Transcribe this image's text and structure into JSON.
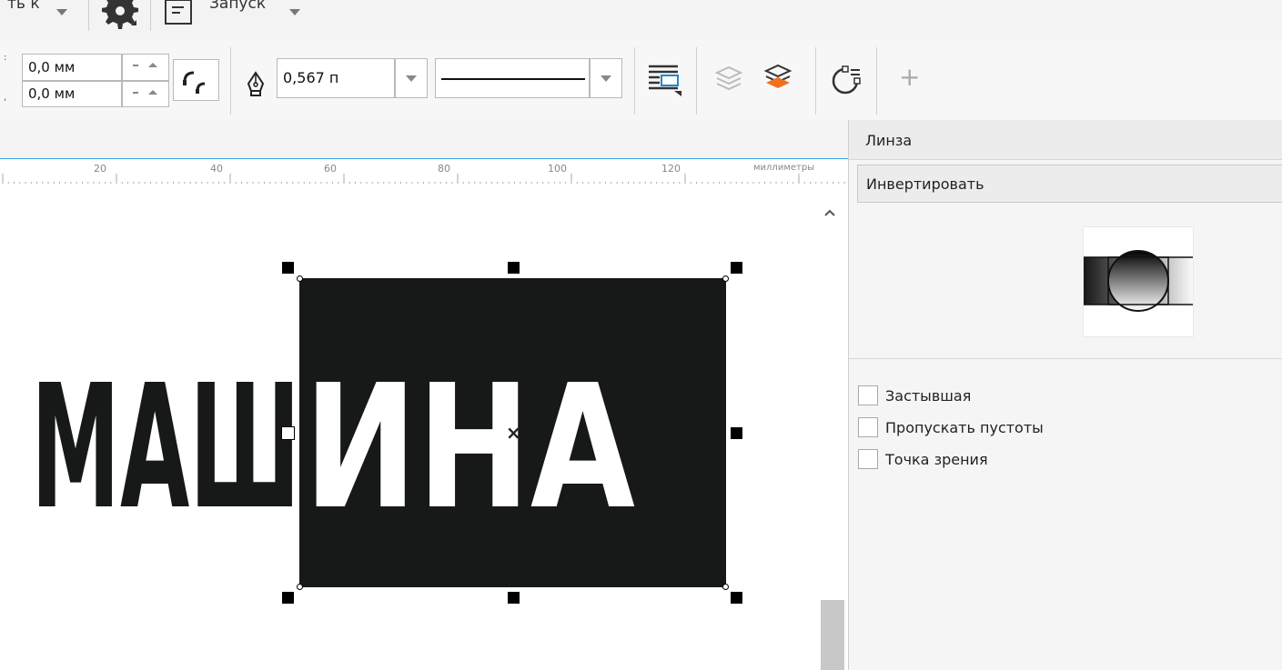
{
  "topbar": {
    "partial_menu_label": "ть к",
    "start_label": "Запуск"
  },
  "propbar": {
    "pos_x": "0,0 мм",
    "pos_y": "0,0 мм",
    "outline_width": "0,567 п",
    "add_symbol": "+"
  },
  "ruler": {
    "unit_label": "миллиметры",
    "ticks": [
      "20",
      "40",
      "60",
      "80",
      "100",
      "120"
    ]
  },
  "canvas": {
    "text_dark": "МАШ",
    "text_light": "ИНА",
    "center_mark": "×"
  },
  "docker": {
    "title": "Линза",
    "lens_type": "Инвертировать",
    "options": [
      {
        "label": "Застывшая",
        "checked": false
      },
      {
        "label": "Пропускать пустоты",
        "checked": false
      },
      {
        "label": "Точка зрения",
        "checked": false
      }
    ]
  },
  "colors": {
    "canvas_rect": "#171918",
    "ruler_accent": "#3aa0e0",
    "layer_accent": "#f07020"
  }
}
